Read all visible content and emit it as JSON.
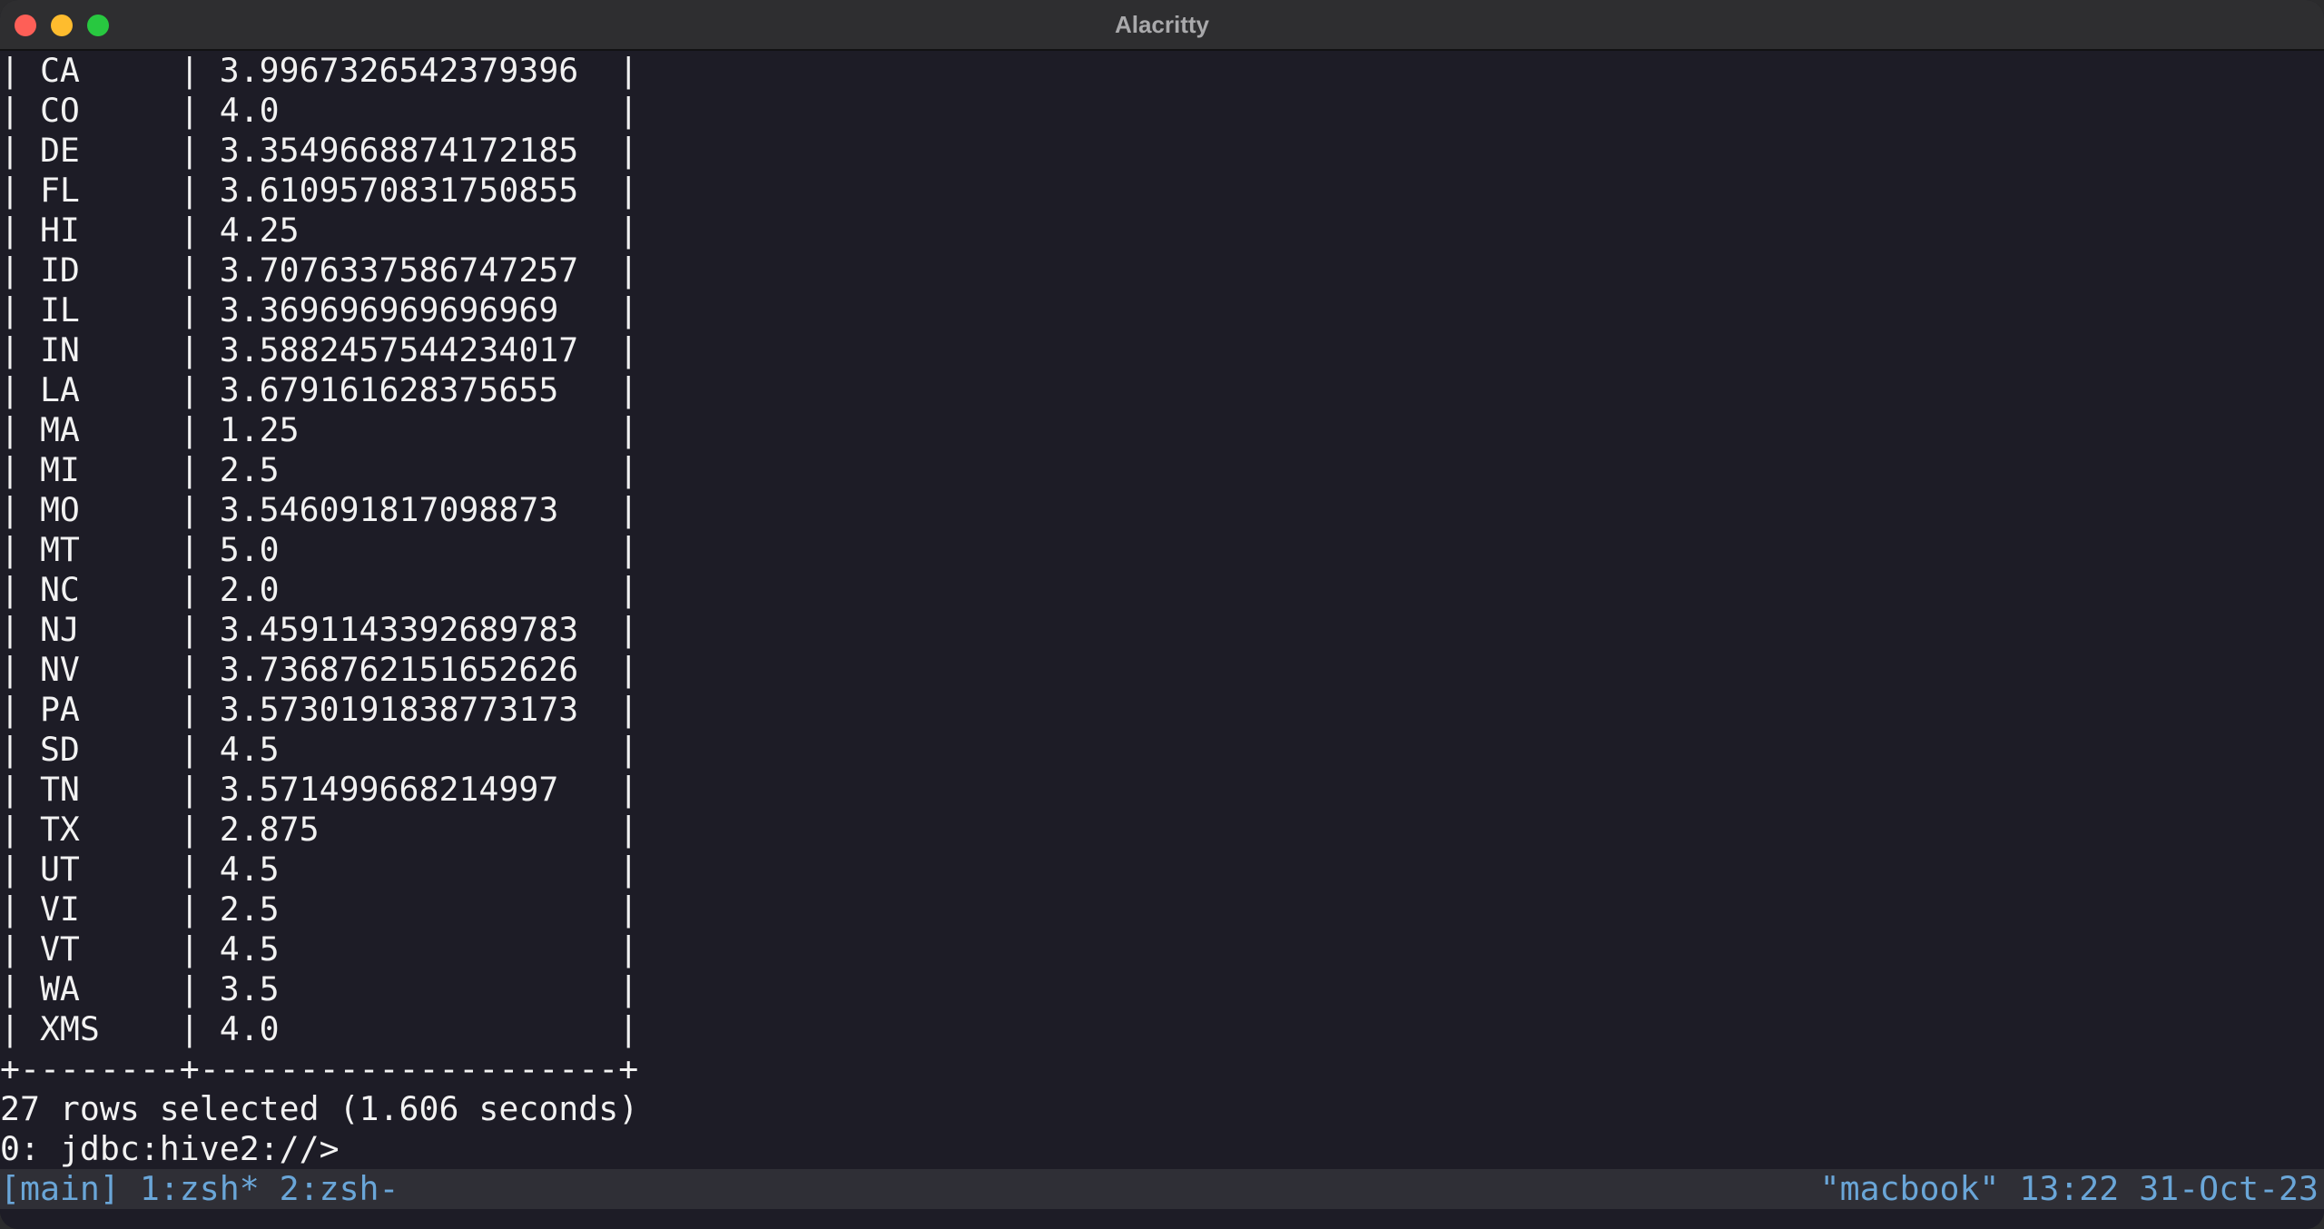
{
  "window": {
    "title": "Alacritty"
  },
  "terminal": {
    "rows": [
      {
        "state": "CA",
        "value": "3.9967326542379396"
      },
      {
        "state": "CO",
        "value": "4.0"
      },
      {
        "state": "DE",
        "value": "3.3549668874172185"
      },
      {
        "state": "FL",
        "value": "3.6109570831750855"
      },
      {
        "state": "HI",
        "value": "4.25"
      },
      {
        "state": "ID",
        "value": "3.7076337586747257"
      },
      {
        "state": "IL",
        "value": "3.369696969696969"
      },
      {
        "state": "IN",
        "value": "3.5882457544234017"
      },
      {
        "state": "LA",
        "value": "3.679161628375655"
      },
      {
        "state": "MA",
        "value": "1.25"
      },
      {
        "state": "MI",
        "value": "2.5"
      },
      {
        "state": "MO",
        "value": "3.546091817098873"
      },
      {
        "state": "MT",
        "value": "5.0"
      },
      {
        "state": "NC",
        "value": "2.0"
      },
      {
        "state": "NJ",
        "value": "3.4591143392689783"
      },
      {
        "state": "NV",
        "value": "3.7368762151652626"
      },
      {
        "state": "PA",
        "value": "3.5730191838773173"
      },
      {
        "state": "SD",
        "value": "4.5"
      },
      {
        "state": "TN",
        "value": "3.571499668214997"
      },
      {
        "state": "TX",
        "value": "2.875"
      },
      {
        "state": "UT",
        "value": "4.5"
      },
      {
        "state": "VI",
        "value": "2.5"
      },
      {
        "state": "VT",
        "value": "4.5"
      },
      {
        "state": "WA",
        "value": "3.5"
      },
      {
        "state": "XMS",
        "value": "4.0"
      }
    ],
    "separator": "+--------+---------------------+",
    "summary": "27 rows selected (1.606 seconds)",
    "prompt": "0: jdbc:hive2://>"
  },
  "tmux": {
    "left": "[main] 1:zsh* 2:zsh-",
    "right": "\"macbook\" 13:22 31-Oct-23"
  }
}
